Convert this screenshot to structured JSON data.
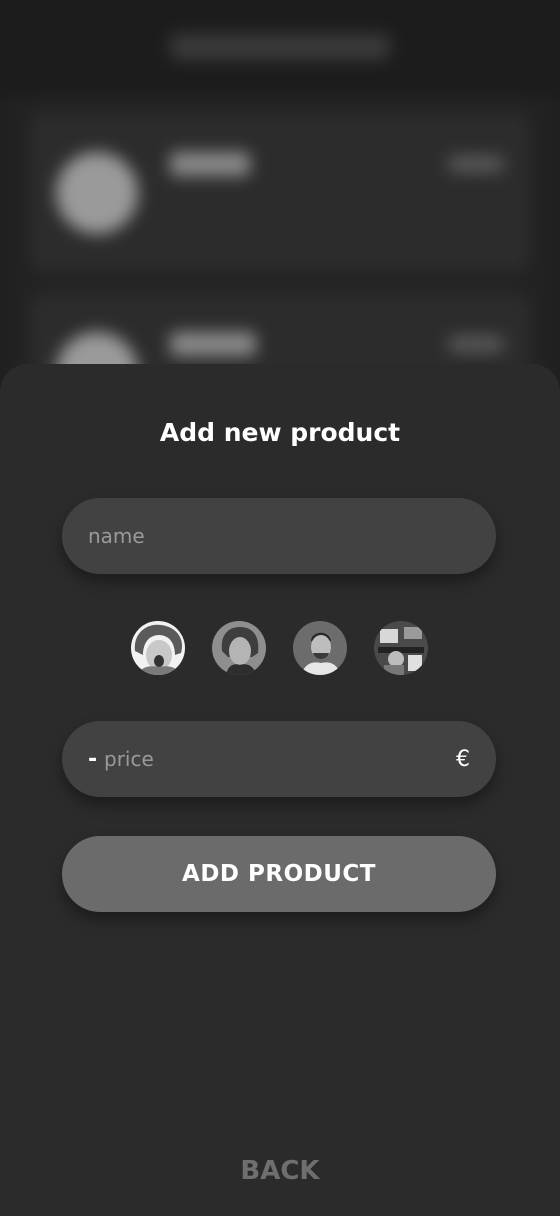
{
  "background": {
    "blurred": true,
    "note_visible_content": "blurred shopping list behind modal"
  },
  "sheet": {
    "title": "Add new product",
    "name_field": {
      "placeholder": "name",
      "value": ""
    },
    "avatars": [
      {
        "name": "avatar-1",
        "selected": true
      },
      {
        "name": "avatar-2",
        "selected": false
      },
      {
        "name": "avatar-3",
        "selected": false
      },
      {
        "name": "avatar-4",
        "selected": false
      }
    ],
    "price_field": {
      "sign": "-",
      "placeholder": "price",
      "value": "",
      "currency": "€"
    },
    "add_button_label": "ADD PRODUCT",
    "back_label": "BACK"
  },
  "colors": {
    "sheet_bg": "#2b2b2b",
    "field_bg": "#424242",
    "button_bg": "#6b6b6b",
    "back_text": "#6f6f6f"
  }
}
